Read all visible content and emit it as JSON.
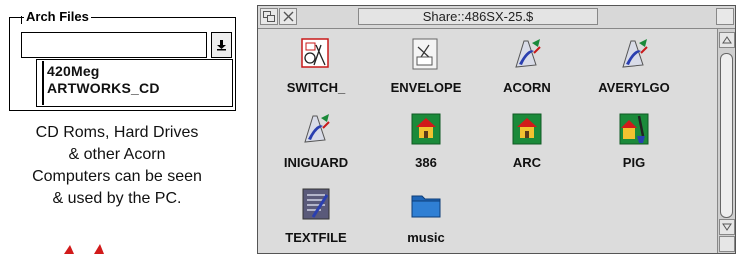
{
  "arch_files": {
    "title": "Arch Files",
    "field_value": "",
    "menu_icon": "menu-arrow-icon",
    "list_items": [
      "420Meg",
      "ARTWORKS_CD"
    ]
  },
  "caption": {
    "line1": "CD Roms, Hard Drives",
    "line2": "& other Acorn",
    "line3": "Computers can be seen",
    "line4": "& used by the PC."
  },
  "filer": {
    "title": "Share::486SX-25.$",
    "files": [
      {
        "name": "SWITCH_",
        "icon": "application-icon"
      },
      {
        "name": "ENVELOPE",
        "icon": "envelope-icon"
      },
      {
        "name": "ACORN",
        "icon": "drawfile-icon"
      },
      {
        "name": "AVERYLGO",
        "icon": "drawfile-icon"
      },
      {
        "name": "INIGUARD",
        "icon": "drawfile-icon"
      },
      {
        "name": "386",
        "icon": "house-icon"
      },
      {
        "name": "ARC",
        "icon": "house-icon"
      },
      {
        "name": "PIG",
        "icon": "paint-icon"
      },
      {
        "name": "TEXTFILE",
        "icon": "textfile-icon"
      },
      {
        "name": "music",
        "icon": "folder-icon"
      }
    ]
  },
  "colors": {
    "window_bg": "#dcdcdc",
    "folder_blue": "#1f66b8",
    "sprite_green": "#1b8a3a",
    "accent_red": "#d11a1a"
  }
}
